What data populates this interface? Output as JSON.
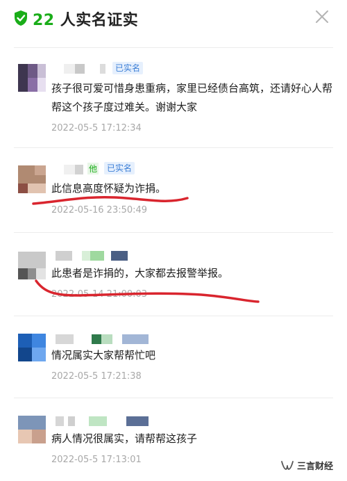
{
  "header": {
    "count": "22",
    "title": "人实名证实",
    "close_icon": "close-icon",
    "shield_icon": "shield-check-icon",
    "accent_color": "#1aad19"
  },
  "comments": [
    {
      "tag": "已实名",
      "text": "孩子很可爱可惜身患重病，家里已经债台高筑，还请好心人帮帮这个孩子度过难关。谢谢大家",
      "time": "2022-05-5 17:12:34"
    },
    {
      "name_fragment": "他",
      "tag": "已实名",
      "text": "此信息高度怀疑为诈捐。",
      "time": "2022-05-16 23:50:49"
    },
    {
      "text": "此患者是诈捐的，大家都去报警举报。",
      "time": "2022-05-14 21:00:03"
    },
    {
      "text": "情况属实大家帮帮忙吧",
      "time": "2022-05-5 17:21:38"
    },
    {
      "text": "病人情况很属实，请帮帮这孩子",
      "time": "2022-05-5 17:13:01"
    }
  ],
  "watermark": {
    "text": "三言财经",
    "icon": "wechat-channel-icon"
  },
  "annotation_color": "#d9252e"
}
